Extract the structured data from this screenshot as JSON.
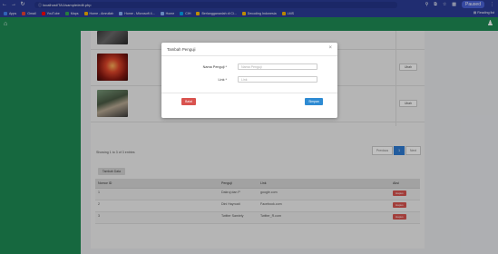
{
  "browser": {
    "url": "localhost/TA1/sample/edit.php",
    "back_icon": "arrow-left",
    "forward_icon": "arrow-right",
    "reload_icon": "reload",
    "profile_label": "Paused",
    "reading_list": "Reading list",
    "bookmarks": [
      {
        "label": "Apps",
        "color": "#4285f4"
      },
      {
        "label": "Gmail",
        "color": "#ea4335"
      },
      {
        "label": "YouTube",
        "color": "#ff0000"
      },
      {
        "label": "Maps",
        "color": "#34a853"
      },
      {
        "label": "Home - Amrullah",
        "color": "#f4b400"
      },
      {
        "label": "Home - Microsoft 4...",
        "color": "#8ab4f8"
      },
      {
        "label": "Home",
        "color": "#8ab4f8"
      },
      {
        "label": "CIH",
        "color": "#00a4ef"
      },
      {
        "label": "Berlanggananlah di Ci...",
        "color": "#fbbc05"
      },
      {
        "label": "Decoding Indonesia",
        "color": "#fbbc05"
      },
      {
        "label": "LMS",
        "color": "#f4b400"
      }
    ]
  },
  "app": {
    "accent": "#1e8b55",
    "home_icon": "home-icon",
    "user_icon": "user-icon"
  },
  "list": {
    "rows": [
      {
        "image": "photo-landscape-dark"
      },
      {
        "image": "photo-red-fire",
        "action": "Ubah"
      },
      {
        "image": "photo-group-people",
        "action": "Ubah"
      }
    ],
    "showing": "Showing 1 to 3 of 3 entries",
    "pager": {
      "prev": "Previous",
      "page": "1",
      "next": "Next"
    }
  },
  "table": {
    "tambah_label": "Tambah Data",
    "headers": [
      "Nomor ID",
      "Penguji",
      "Link",
      "Aksi"
    ],
    "rows": [
      {
        "id": "1",
        "penguji": "Dakruj dan P",
        "link": "google.com",
        "aksi": "Hapus"
      },
      {
        "id": "2",
        "penguji": "Dini Hayroati",
        "link": "Facebook.com",
        "aksi": "Hapus"
      },
      {
        "id": "3",
        "penguji": "Twitter Samiely",
        "link": "Twitter_R.com",
        "aksi": "Hapus"
      }
    ]
  },
  "modal": {
    "title": "Tambah Penguji",
    "close": "×",
    "fields": [
      {
        "label": "Nama Penguji *",
        "placeholder": "Nama Penguji"
      },
      {
        "label": "Link *",
        "placeholder": "Link"
      }
    ],
    "batal": "Batal",
    "simpan": "Simpan"
  }
}
